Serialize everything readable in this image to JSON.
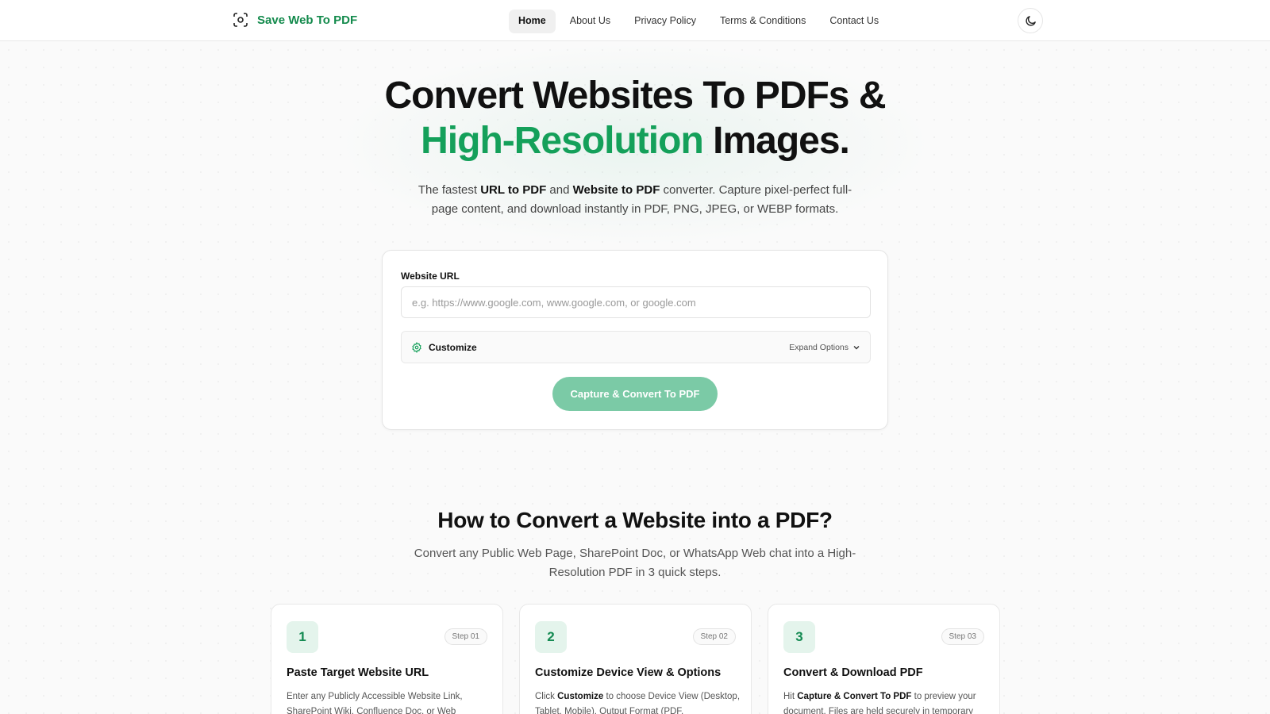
{
  "brand": {
    "name": "Save Web To PDF",
    "accent": "#14a05a"
  },
  "nav": {
    "items": [
      {
        "label": "Home",
        "active": true
      },
      {
        "label": "About Us"
      },
      {
        "label": "Privacy Policy"
      },
      {
        "label": "Terms & Conditions"
      },
      {
        "label": "Contact Us"
      }
    ],
    "theme_icon": "moon-icon"
  },
  "hero": {
    "title_part1": "Convert Websites To PDFs & ",
    "title_green": "High-Resolution",
    "title_part2": " Images.",
    "subtitle_part1": "The fastest ",
    "subtitle_bold1": "URL to PDF",
    "subtitle_part2": " and ",
    "subtitle_bold2": "Website to PDF",
    "subtitle_part3": " converter. Capture pixel-perfect full-page content, and download instantly in PDF, PNG, JPEG, or WEBP formats."
  },
  "form": {
    "url_label": "Website URL",
    "url_value": "",
    "url_placeholder": "e.g. https://www.google.com, www.google.com, or google.com",
    "customize_label": "Customize",
    "expand_label": "Expand Options",
    "capture_label": "Capture & Convert To PDF"
  },
  "how": {
    "title": "How to Convert a Website into a PDF?",
    "subtitle": "Convert any Public Web Page, SharePoint Doc, or WhatsApp Web chat into a High-Resolution PDF in 3 quick steps.",
    "steps": [
      {
        "num": "1",
        "badge": "Step 01",
        "title": "Paste Target Website URL",
        "desc_pre": "Enter any Publicly Accessible Website Link, SharePoint Wiki, Confluence Doc, or Web",
        "desc_bold": "",
        "desc_post": ""
      },
      {
        "num": "2",
        "badge": "Step 02",
        "title": "Customize Device View & Options",
        "desc_pre": "Click ",
        "desc_bold": "Customize",
        "desc_post": " to choose Device View (Desktop, Tablet, Mobile), Output Format (PDF,"
      },
      {
        "num": "3",
        "badge": "Step 03",
        "title": "Convert & Download PDF",
        "desc_pre": "Hit ",
        "desc_bold": "Capture & Convert To PDF",
        "desc_post": " to preview your document. Files are held securely in temporary"
      }
    ]
  }
}
